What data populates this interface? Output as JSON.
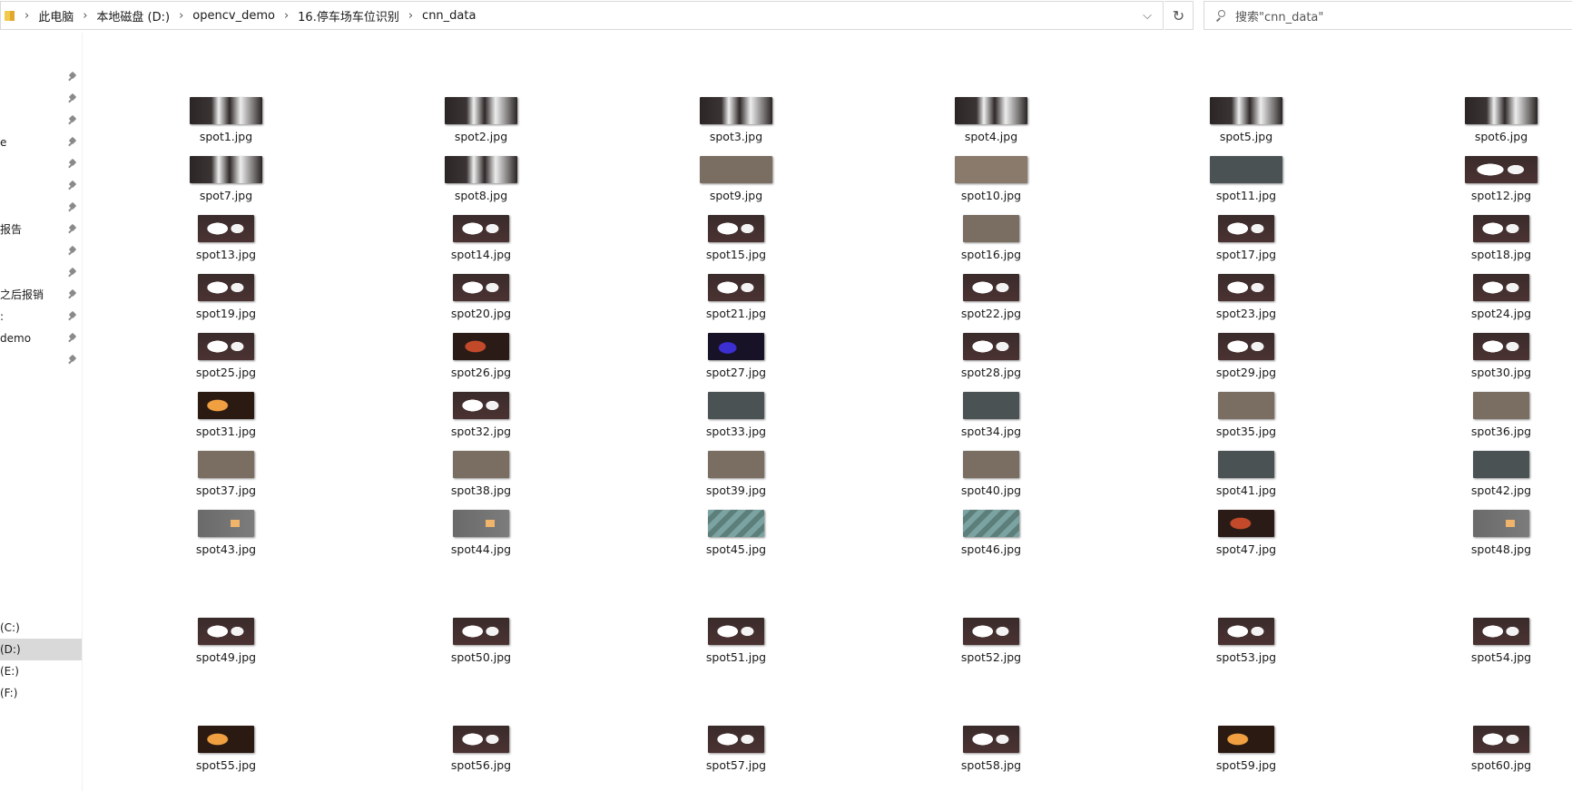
{
  "breadcrumb": [
    "此电脑",
    "本地磁盘 (D:)",
    "opencv_demo",
    "16.停车场车位识别",
    "cnn_data"
  ],
  "search": {
    "placeholder": "搜索\"cnn_data\""
  },
  "icons": {
    "folder": "folder-icon",
    "dropdown": "chevron-down-icon",
    "refresh": "refresh-icon",
    "search": "search-icon",
    "pin": "pin-icon"
  },
  "sidebar": {
    "quick_access": [
      {
        "label": ""
      },
      {
        "label": ""
      },
      {
        "label": ""
      },
      {
        "label": "e"
      },
      {
        "label": ""
      },
      {
        "label": ""
      },
      {
        "label": ""
      },
      {
        "label": "报告"
      },
      {
        "label": ""
      },
      {
        "label": ""
      },
      {
        "label": "之后报销"
      },
      {
        "label": ":"
      },
      {
        "label": "demo"
      },
      {
        "label": ""
      }
    ],
    "drives": [
      {
        "label": "(C:)",
        "selected": false
      },
      {
        "label": "(D:)",
        "selected": true
      },
      {
        "label": "(E:)",
        "selected": false
      },
      {
        "label": "(F:)",
        "selected": false
      }
    ]
  },
  "files": [
    "spot1.jpg",
    "spot2.jpg",
    "spot3.jpg",
    "spot4.jpg",
    "spot5.jpg",
    "spot6.jpg",
    "spot7.jpg",
    "spot8.jpg",
    "spot9.jpg",
    "spot10.jpg",
    "spot11.jpg",
    "spot12.jpg",
    "spot13.jpg",
    "spot14.jpg",
    "spot15.jpg",
    "spot16.jpg",
    "spot17.jpg",
    "spot18.jpg",
    "spot19.jpg",
    "spot20.jpg",
    "spot21.jpg",
    "spot22.jpg",
    "spot23.jpg",
    "spot24.jpg",
    "spot25.jpg",
    "spot26.jpg",
    "spot27.jpg",
    "spot28.jpg",
    "spot29.jpg",
    "spot30.jpg",
    "spot31.jpg",
    "spot32.jpg",
    "spot33.jpg",
    "spot34.jpg",
    "spot35.jpg",
    "spot36.jpg",
    "spot37.jpg",
    "spot38.jpg",
    "spot39.jpg",
    "spot40.jpg",
    "spot41.jpg",
    "spot42.jpg",
    "spot43.jpg",
    "spot44.jpg",
    "spot45.jpg",
    "spot46.jpg",
    "spot47.jpg",
    "spot48.jpg",
    "spot49.jpg",
    "spot50.jpg",
    "spot51.jpg",
    "spot52.jpg",
    "spot53.jpg",
    "spot54.jpg",
    "spot55.jpg",
    "spot56.jpg",
    "spot57.jpg",
    "spot58.jpg",
    "spot59.jpg",
    "spot60.jpg"
  ]
}
